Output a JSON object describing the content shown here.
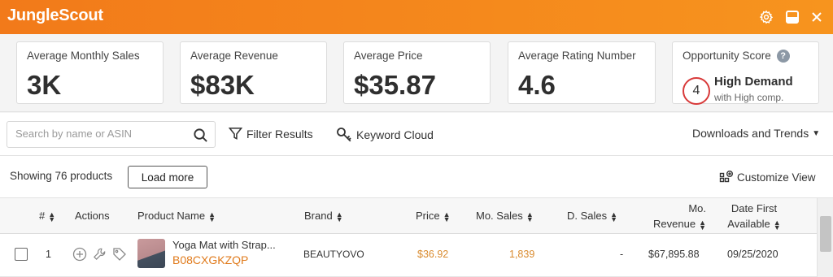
{
  "app": {
    "title": "JungleScout"
  },
  "window": {
    "settings_icon": "gear-icon",
    "minimize_icon": "minimize-icon",
    "close_icon": "close-icon"
  },
  "stats": [
    {
      "label": "Average Monthly Sales",
      "value": "3K"
    },
    {
      "label": "Average Revenue",
      "value": "$83K"
    },
    {
      "label": "Average Price",
      "value": "$35.87"
    },
    {
      "label": "Average Rating Number",
      "value": "4.6"
    }
  ],
  "opportunity": {
    "label": "Opportunity Score",
    "help": "?",
    "score": "4",
    "title": "High Demand",
    "subtitle": "with High comp.",
    "circle_color": "#d83a3a"
  },
  "toolbar": {
    "search_placeholder": "Search by name or ASIN",
    "filter_label": "Filter Results",
    "keyword_label": "Keyword Cloud",
    "downloads_label": "Downloads and Trends"
  },
  "listing": {
    "showing_text": "Showing 76 products",
    "load_more_label": "Load more",
    "customize_label": "Customize View"
  },
  "columns": {
    "num": "#",
    "actions": "Actions",
    "product_name": "Product Name",
    "brand": "Brand",
    "price": "Price",
    "mo_sales": "Mo. Sales",
    "d_sales": "D. Sales",
    "mo_revenue_1": "Mo.",
    "mo_revenue_2": "Revenue",
    "date_first_1": "Date First",
    "date_first_2": "Available"
  },
  "rows": [
    {
      "num": "1",
      "name": "Yoga Mat with Strap...",
      "asin": "B08CXGKZQP",
      "brand": "BEAUTYOVO",
      "price": "$36.92",
      "mo_sales": "1,839",
      "d_sales": "-",
      "mo_revenue": "$67,895.88",
      "date_first": "09/25/2020"
    }
  ],
  "colors": {
    "brand_orange": "#f27a1a",
    "accent_orange": "#e07a1b",
    "value_orange": "#d98a2d"
  }
}
